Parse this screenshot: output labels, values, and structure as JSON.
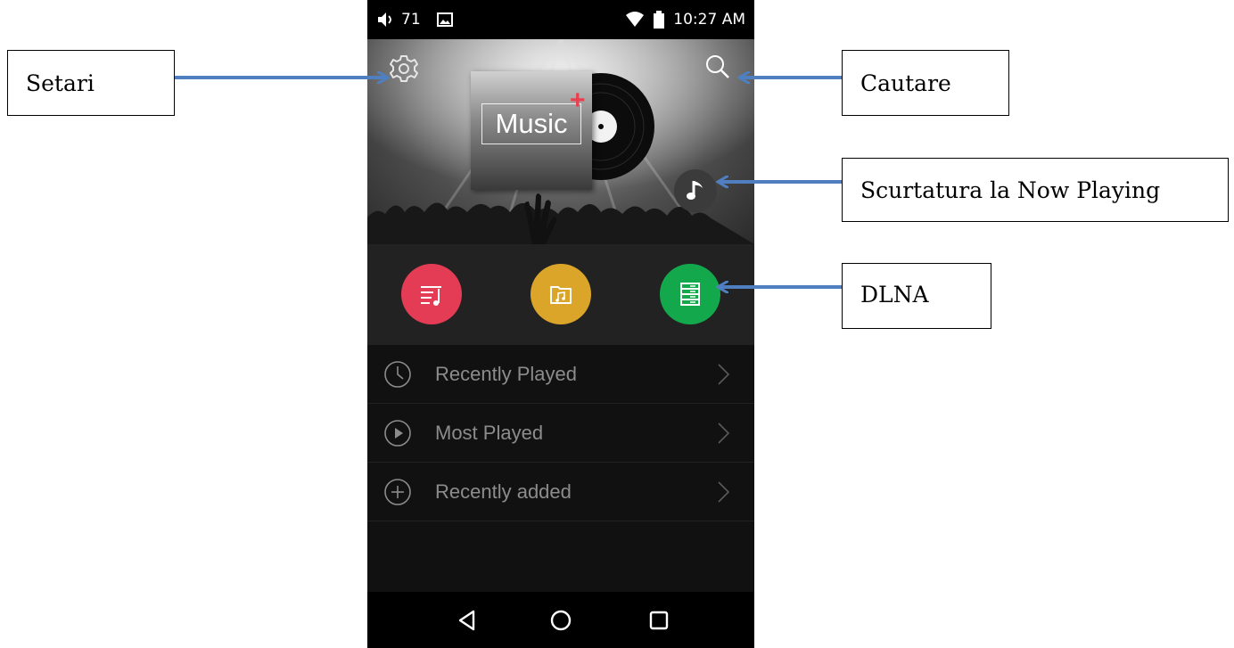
{
  "status_bar": {
    "volume": "71",
    "time": "10:27 AM"
  },
  "hero": {
    "album_title": "Music",
    "album_plus": "+"
  },
  "annotations": {
    "settings": "Setari",
    "search": "Cautare",
    "now_playing": "Scurtatura la Now Playing",
    "dlna": "DLNA"
  },
  "quick_buttons": [
    {
      "icon": "playlist-icon",
      "color": "#e53c55"
    },
    {
      "icon": "music-folder-icon",
      "color": "#dba52a"
    },
    {
      "icon": "dlna-server-icon",
      "color": "#14a84c"
    }
  ],
  "list_items": [
    {
      "icon": "clock-icon",
      "label": "Recently Played"
    },
    {
      "icon": "play-circle-icon",
      "label": "Most Played"
    },
    {
      "icon": "plus-circle-icon",
      "label": "Recently added"
    }
  ],
  "colors": {
    "arrow": "#4f7fc0",
    "accent_plus": "#e8404f"
  }
}
